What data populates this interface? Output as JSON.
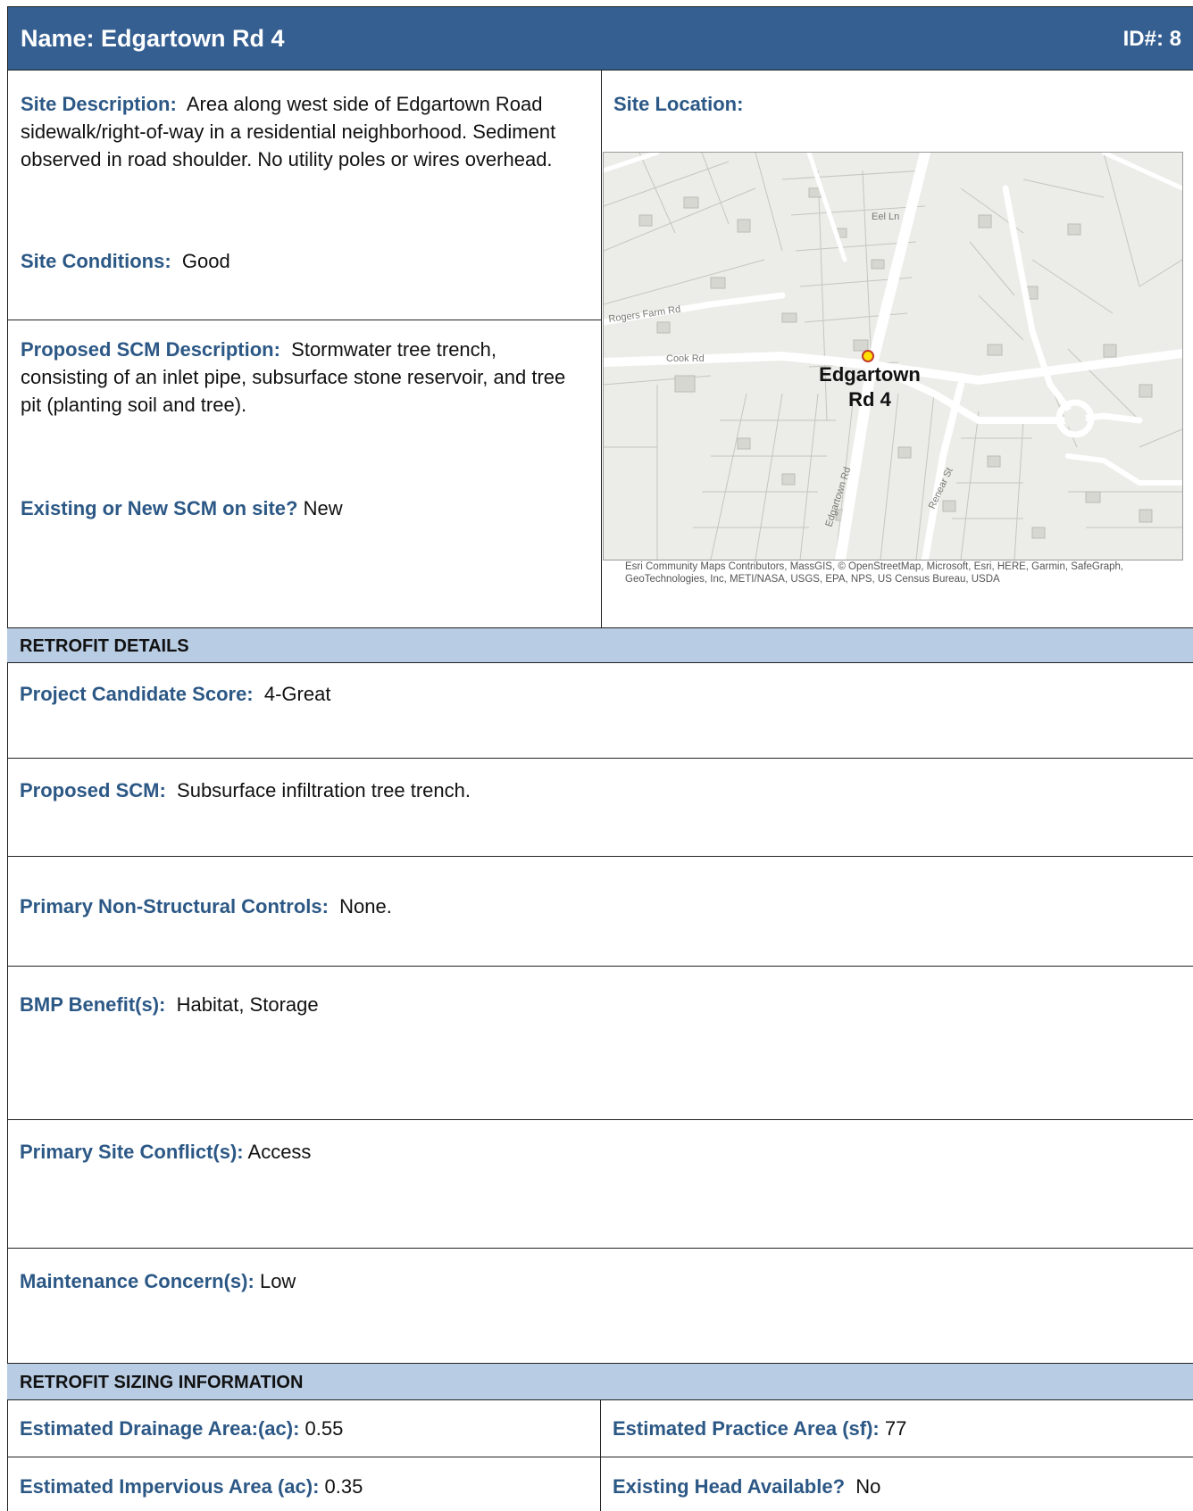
{
  "header": {
    "name": "Name: Edgartown Rd 4",
    "id": "ID#: 8"
  },
  "site": {
    "description_label": "Site Description:",
    "description_text": "Area along west side of Edgartown Road sidewalk/right-of-way in a residential neighborhood. Sediment observed in road shoulder. No utility poles or wires overhead.",
    "conditions_label": "Site Conditions:",
    "conditions_text": "Good",
    "location_label": "Site Location:"
  },
  "scm": {
    "description_label": "Proposed SCM Description:",
    "description_text": "Stormwater tree trench, consisting of an inlet pipe, subsurface stone reservoir, and tree pit (planting soil and tree).",
    "existing_label": "Existing or New SCM on site?",
    "existing_text": "New"
  },
  "map": {
    "marker_label_line1": "Edgartown",
    "marker_label_line2": "Rd 4",
    "streets": [
      "Eel Ln",
      "Rogers Farm Rd",
      "Cook Rd",
      "Edgartown Rd",
      "Renear St"
    ],
    "credit": "Esri Community Maps Contributors, MassGIS, © OpenStreetMap, Microsoft, Esri, HERE, Garmin, SafeGraph, GeoTechnologies, Inc, METI/NASA, USGS, EPA, NPS, US Census Bureau, USDA",
    "marker_color": "#ffe000"
  },
  "retrofit": {
    "section_title": "RETROFIT DETAILS",
    "score_label": "Project Candidate Score:",
    "score_text": "4-Great",
    "proposed_label": "Proposed SCM:",
    "proposed_text": "Subsurface infiltration tree trench.",
    "nonstructural_label": "Primary Non-Structural Controls:",
    "nonstructural_text": "None.",
    "benefits_label": "BMP Benefit(s):",
    "benefits_text": "Habitat, Storage",
    "conflicts_label": "Primary Site Conflict(s):",
    "conflicts_text": "Access",
    "maintenance_label": "Maintenance Concern(s):",
    "maintenance_text": "Low"
  },
  "sizing": {
    "section_title": "RETROFIT SIZING INFORMATION",
    "drainage_label": "Estimated Drainage Area:(ac):",
    "drainage_text": "0.55",
    "practice_label": "Estimated Practice Area (sf):",
    "practice_text": "77",
    "impervious_label": "Estimated Impervious Area (ac):",
    "impervious_text": "0.35",
    "head_label": "Existing Head Available?",
    "head_text": "No"
  },
  "colors": {
    "header": "#355f91",
    "band": "#b8cce4",
    "label": "#2c5886"
  }
}
